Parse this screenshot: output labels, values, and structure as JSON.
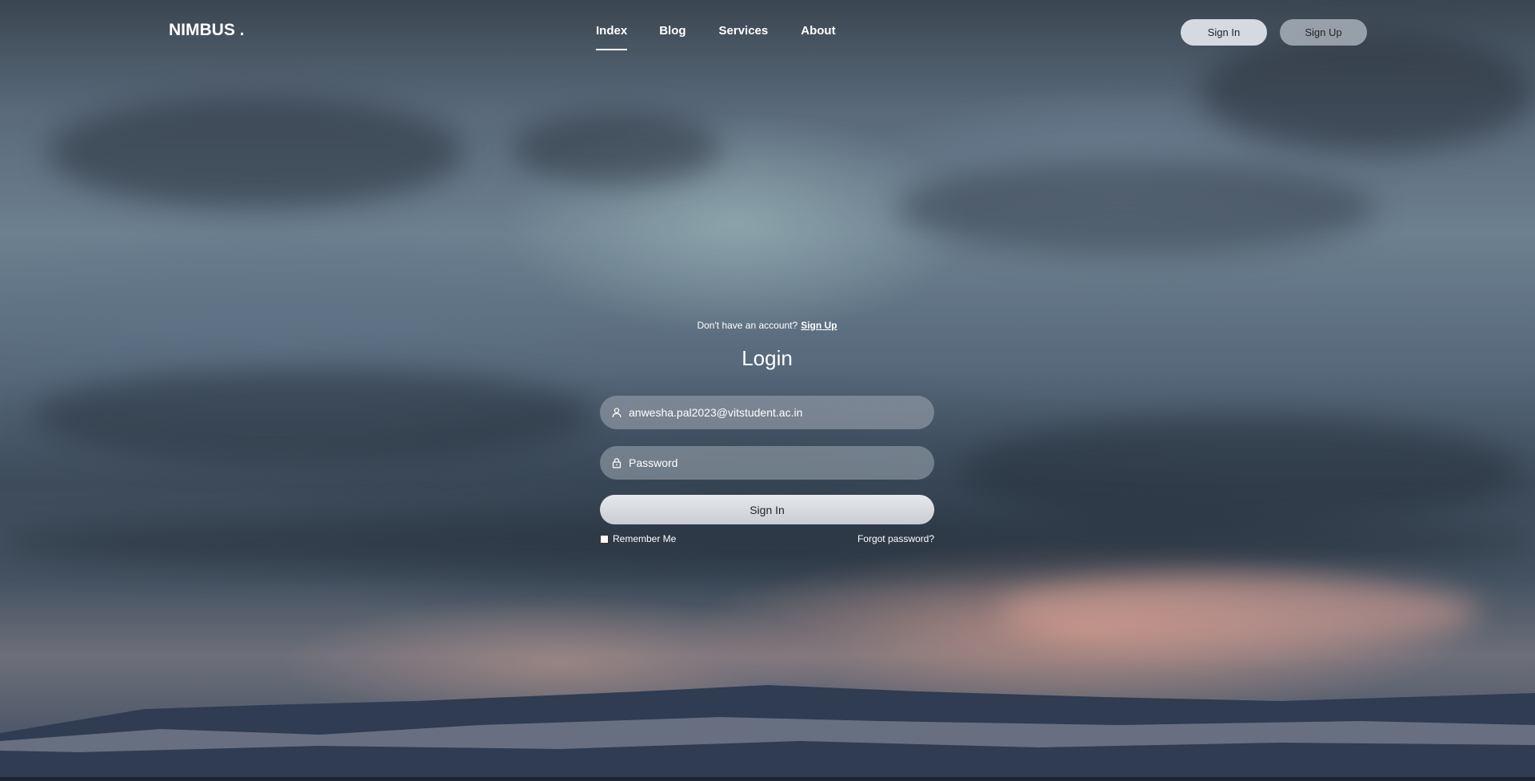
{
  "brand": {
    "logo": "NIMBUS ."
  },
  "nav": {
    "links": [
      {
        "label": "Index",
        "active": true
      },
      {
        "label": "Blog",
        "active": false
      },
      {
        "label": "Services",
        "active": false
      },
      {
        "label": "About",
        "active": false
      }
    ],
    "sign_in_label": "Sign In",
    "sign_up_label": "Sign Up"
  },
  "login": {
    "prompt_text": "Don't have an account?",
    "prompt_link": "Sign Up",
    "title": "Login",
    "email_value": "anwesha.pal2023@vitstudent.ac.in",
    "password_placeholder": "Password",
    "submit_label": "Sign In",
    "remember_label": "Remember Me",
    "remember_checked": false,
    "forgot_label": "Forgot password?"
  },
  "icons": {
    "email": "user-icon",
    "password": "lock-icon"
  },
  "colors": {
    "text": "#ffffff",
    "button": "#e2e6eb",
    "button_text": "#1f2328"
  }
}
